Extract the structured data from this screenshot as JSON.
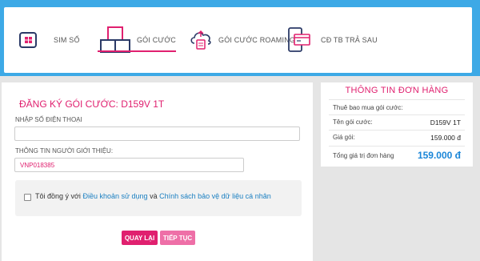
{
  "tabs": [
    {
      "label": "SIM SỐ"
    },
    {
      "label": "GÓI CƯỚC"
    },
    {
      "label": "GÓI CƯỚC ROAMING"
    },
    {
      "label": "CĐ TB TRẢ SAU"
    }
  ],
  "form": {
    "title": "ĐĂNG KÝ GÓI CƯỚC: D159V 1T",
    "phone_label": "NHẬP SỐ ĐIỆN THOẠI",
    "phone_value": "",
    "referrer_label": "THÔNG TIN NGƯỜI GIỚI THIỆU:",
    "referrer_value": "VNP018385",
    "agree_prefix": "Tôi đồng ý với",
    "terms_link": "Điều khoản sử dụng",
    "agree_and": "và",
    "privacy_link": "Chính sách bảo vệ dữ liệu cá nhân",
    "agree_checked": false,
    "back_button": "QUAY LẠI",
    "next_button": "TIẾP TỤC"
  },
  "order": {
    "title": "THÔNG TIN ĐƠN HÀNG",
    "row_fee": "Thuê bao mua gói cước:",
    "row_plan_label": "Tên gói cước:",
    "row_plan_value": "D159V 1T",
    "row_price_label": "Giá gói:",
    "row_price_value": "159.000 đ",
    "row_total_label": "Tổng giá trị đơn hàng",
    "row_total_value": "159.000 đ"
  },
  "colors": {
    "accent": "#e0206f",
    "brand_blue": "#3da9e6",
    "link": "#1a7fc1",
    "total": "#1a86d8"
  },
  "icons": [
    "sim-card-icon",
    "package-boxes-icon",
    "roaming-cloud-sim-icon",
    "phone-card-icon"
  ]
}
